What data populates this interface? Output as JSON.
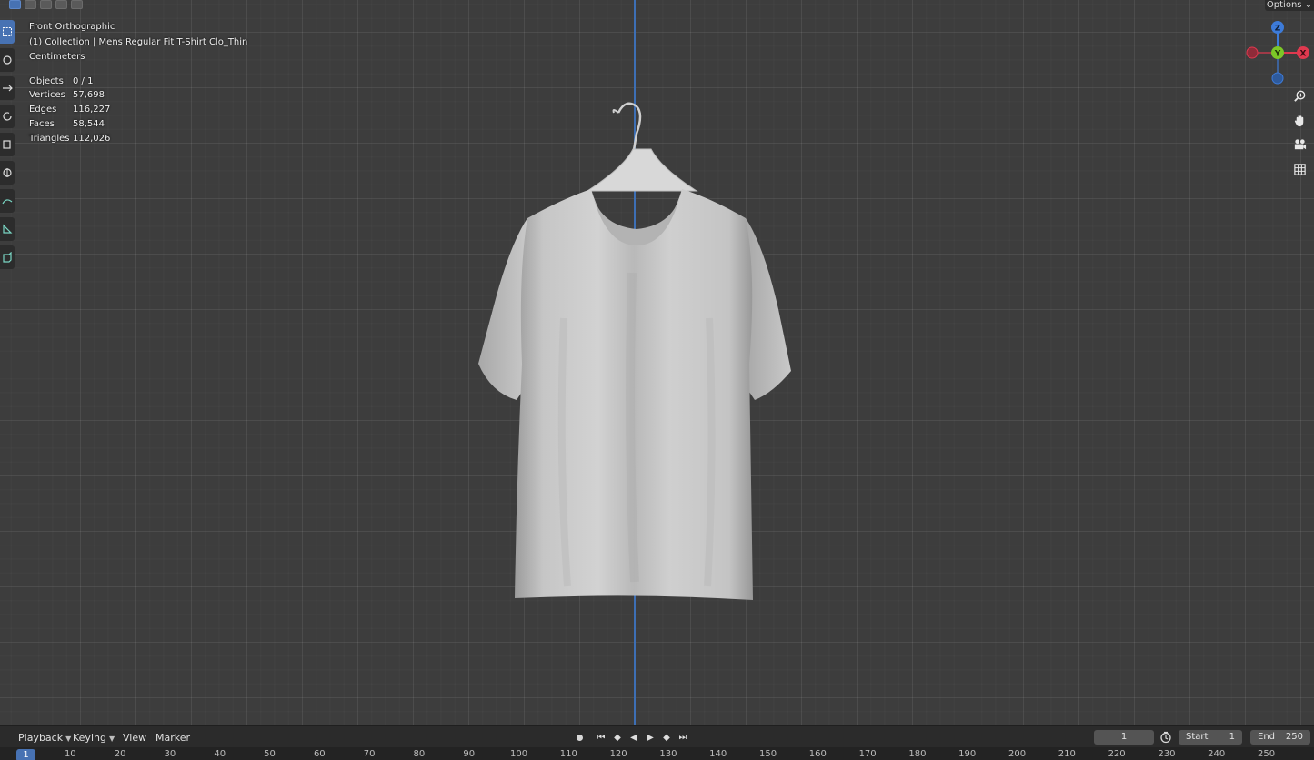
{
  "viewport": {
    "view_name": "Front Orthographic",
    "collection_line": "(1) Collection | Mens Regular Fit T-Shirt Clo_Thin",
    "units": "Centimeters",
    "stats": [
      {
        "label": "Objects",
        "value": "0 / 1"
      },
      {
        "label": "Vertices",
        "value": "57,698"
      },
      {
        "label": "Edges",
        "value": "116,227"
      },
      {
        "label": "Faces",
        "value": "58,544"
      },
      {
        "label": "Triangles",
        "value": "112,026"
      }
    ],
    "options_label": "Options",
    "gizmo": {
      "z": "Z",
      "y": "Y",
      "x": "X"
    },
    "colors": {
      "x_axis": "#e0394f",
      "y_axis": "#7cc727",
      "z_axis": "#3d7bd9",
      "z_line": "#3d6fb5",
      "active": "#4772b3"
    }
  },
  "toolbar": {
    "tools": [
      "select-box-icon",
      "cursor-icon",
      "move-icon",
      "rotate-icon",
      "scale-icon",
      "transform-icon",
      "annotate-icon",
      "measure-icon",
      "add-cube-icon"
    ]
  },
  "nav": [
    "zoom-icon",
    "pan-hand-icon",
    "camera-icon",
    "grid-icon"
  ],
  "timeline": {
    "menus": [
      "Playback",
      "Keying",
      "View",
      "Marker"
    ],
    "current_frame": "1",
    "start_label": "Start",
    "start_value": "1",
    "end_label": "End",
    "end_value": "250",
    "marker_frame": "1",
    "ticks": [
      "10",
      "20",
      "30",
      "40",
      "50",
      "60",
      "70",
      "80",
      "90",
      "100",
      "110",
      "120",
      "130",
      "140",
      "150",
      "160",
      "170",
      "180",
      "190",
      "200",
      "210",
      "220",
      "230",
      "240",
      "250"
    ]
  }
}
